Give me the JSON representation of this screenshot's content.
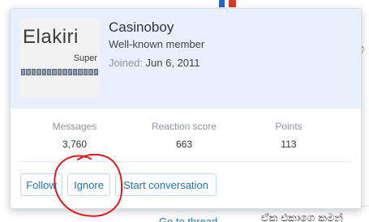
{
  "background": {
    "bottom_link": "Go to thread",
    "bottom_text": "ඒක එකාගෙ කුමන්",
    "right_text": "ඉ"
  },
  "member": {
    "name": "Casinoboy",
    "title": "Well-known member",
    "joined_label": "Joined:",
    "joined_date": "Jun 6, 2011"
  },
  "avatar": {
    "title": "Elakiri",
    "subtitle": "Super"
  },
  "stats": [
    {
      "label": "Messages",
      "value": "3,760"
    },
    {
      "label": "Reaction score",
      "value": "663"
    },
    {
      "label": "Points",
      "value": "113"
    }
  ],
  "actions": {
    "follow": "Follow",
    "ignore": "Ignore",
    "start_conversation": "Start conversation"
  },
  "colors": {
    "header_background": "#e8f0fb",
    "link_blue": "#2577b1",
    "annotation_red": "#e01a1a"
  }
}
